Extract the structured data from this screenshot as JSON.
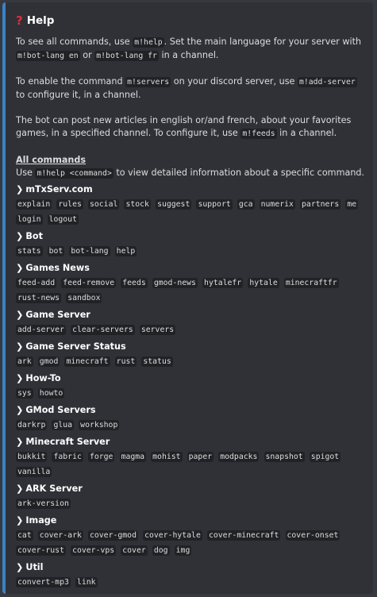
{
  "embed": {
    "accent_color": "#3b82c4",
    "title": "Help",
    "title_icon": "red-question-mark-icon"
  },
  "intro": {
    "p1": [
      {
        "t": "To see all commands, use "
      },
      {
        "c": "m!help"
      },
      {
        "t": ". Set the main language for your server with "
      },
      {
        "c": "m!bot-lang en"
      },
      {
        "t": " or "
      },
      {
        "c": "m!bot-lang fr"
      },
      {
        "t": " in a channel."
      }
    ],
    "p2": [
      {
        "t": "To enable the command "
      },
      {
        "c": "m!servers"
      },
      {
        "t": " on your discord server, use "
      },
      {
        "c": "m!add-server"
      },
      {
        "t": " to configure it, in a channel."
      }
    ],
    "p3": [
      {
        "t": "The bot can post new articles in english or/and french, about your favorites games, in a specified channel. To configure it, use "
      },
      {
        "c": "m!feeds"
      },
      {
        "t": " in a channel."
      }
    ]
  },
  "all_commands": {
    "heading": "All commands",
    "hint": [
      {
        "t": "Use "
      },
      {
        "c": "m!help <command>"
      },
      {
        "t": " to view detailed information about a specific command."
      }
    ]
  },
  "categories": [
    {
      "name": "mTxServ.com",
      "commands": [
        "explain",
        "rules",
        "social",
        "stock",
        "suggest",
        "support",
        "gca",
        "numerix",
        "partners",
        "me",
        "login",
        "logout"
      ]
    },
    {
      "name": "Bot",
      "commands": [
        "stats",
        "bot",
        "bot-lang",
        "help"
      ]
    },
    {
      "name": "Games News",
      "commands": [
        "feed-add",
        "feed-remove",
        "feeds",
        "gmod-news",
        "hytalefr",
        "hytale",
        "minecraftfr",
        "rust-news",
        "sandbox"
      ]
    },
    {
      "name": "Game Server",
      "commands": [
        "add-server",
        "clear-servers",
        "servers"
      ]
    },
    {
      "name": "Game Server Status",
      "commands": [
        "ark",
        "gmod",
        "minecraft",
        "rust",
        "status"
      ]
    },
    {
      "name": "How-To",
      "commands": [
        "sys",
        "howto"
      ]
    },
    {
      "name": "GMod Servers",
      "commands": [
        "darkrp",
        "glua",
        "workshop"
      ]
    },
    {
      "name": "Minecraft Server",
      "commands": [
        "bukkit",
        "fabric",
        "forge",
        "magma",
        "mohist",
        "paper",
        "modpacks",
        "snapshot",
        "spigot",
        "vanilla"
      ]
    },
    {
      "name": "ARK Server",
      "commands": [
        "ark-version"
      ]
    },
    {
      "name": "Image",
      "commands": [
        "cat",
        "cover-ark",
        "cover-gmod",
        "cover-hytale",
        "cover-minecraft",
        "cover-onset",
        "cover-rust",
        "cover-vps",
        "cover",
        "dog",
        "img"
      ]
    },
    {
      "name": "Util",
      "commands": [
        "convert-mp3",
        "link"
      ]
    }
  ]
}
